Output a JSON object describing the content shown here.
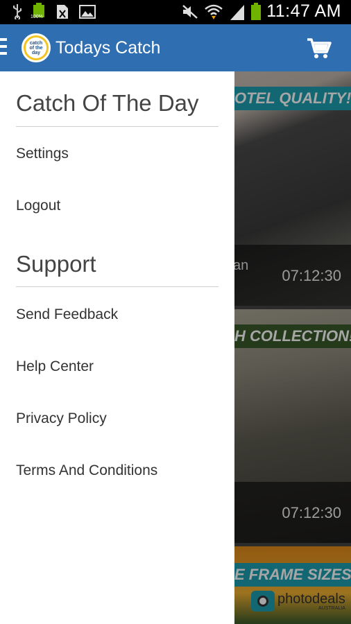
{
  "status_bar": {
    "time": "11:47 AM",
    "battery_small": "100%",
    "icons": [
      "usb-icon",
      "battery-full-icon",
      "no-sim-icon",
      "image-icon",
      "mute-icon",
      "wifi-icon",
      "signal-icon",
      "battery-icon"
    ]
  },
  "app_bar": {
    "title": "Todays Catch",
    "logo_text": [
      "catch",
      "of the",
      "day"
    ],
    "colors": {
      "bar": "#2f6fb1",
      "logo": "#f3c321"
    }
  },
  "drawer": {
    "sections": [
      {
        "title": "Catch Of The Day",
        "items": [
          "Settings",
          "Logout"
        ]
      },
      {
        "title": "Support",
        "items": [
          "Send Feedback",
          "Help Center",
          "Privacy Policy",
          "Terms And Conditions"
        ]
      }
    ]
  },
  "content": {
    "cards": [
      {
        "banner": "OTEL QUALITY!",
        "subtitle": "an",
        "countdown": "07:12:30"
      },
      {
        "banner": "H COLLECTION!",
        "subtitle": "",
        "countdown": "07:12:30"
      },
      {
        "banner": "E FRAME SIZES!",
        "brand": "photodeals",
        "brand_sub": "AUSTRALIA"
      }
    ]
  }
}
